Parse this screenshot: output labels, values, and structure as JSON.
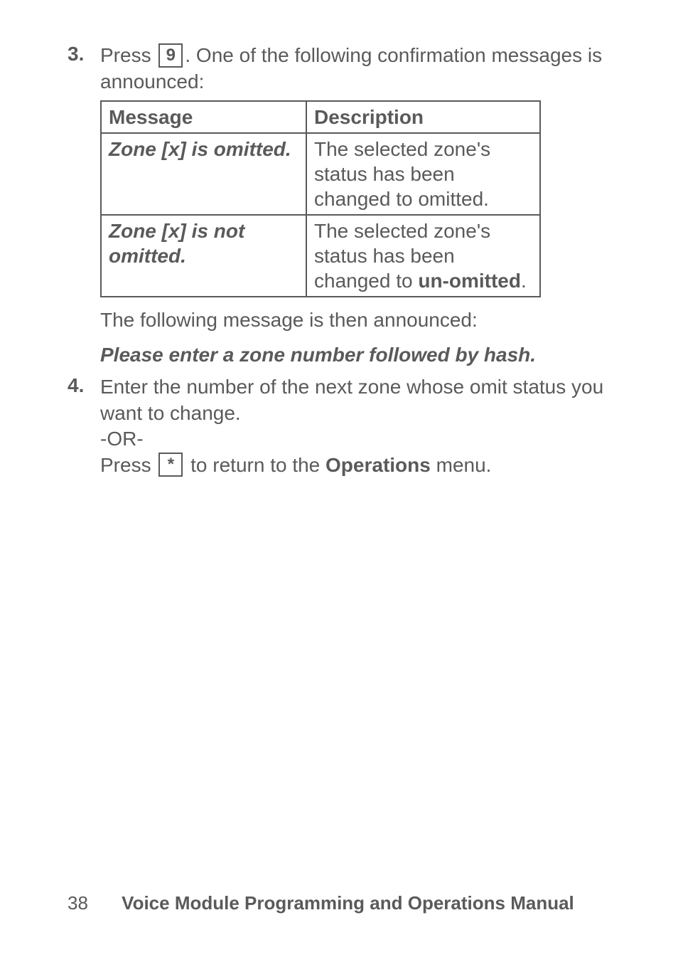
{
  "step3": {
    "number": "3.",
    "press": "Press ",
    "key": "9",
    "afterKey": ". One of the following confirmation messages is announced:"
  },
  "table": {
    "header": {
      "col1": "Message",
      "col2": "Description"
    },
    "rows": [
      {
        "message": "Zone [x] is omitted.",
        "descPlain": "The selected zone's status has been changed to omitted."
      },
      {
        "message": "Zone [x] is not omitted.",
        "descPrefix": "The selected zone's status has been changed to ",
        "descBold": "un-omitted",
        "descSuffix": "."
      }
    ]
  },
  "afterTable": {
    "line1": "The following message is then announced:",
    "prompt": "Please enter a zone number followed by hash."
  },
  "step4": {
    "number": "4.",
    "line1": "Enter the number of the next zone whose omit status you want to change.",
    "or": "-OR-",
    "pressPrefix": "Press ",
    "key": "*",
    "pressMid": " to return to the ",
    "bold": "Operations",
    "pressSuffix": " menu."
  },
  "footer": {
    "page": "38",
    "title": "Voice Module Programming and Operations Manual"
  }
}
